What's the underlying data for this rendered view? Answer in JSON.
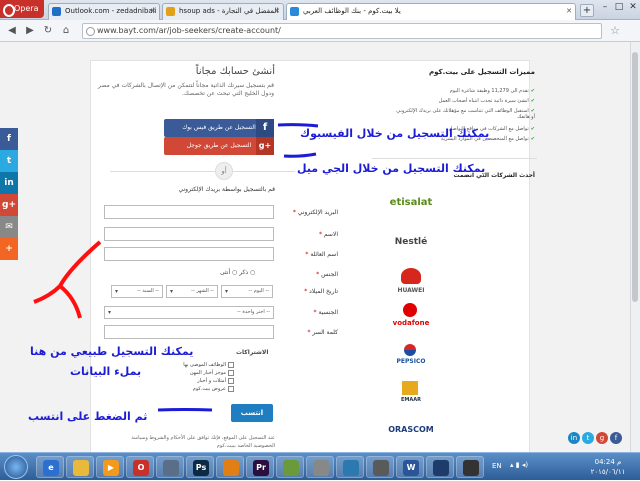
{
  "browser": {
    "opera_label": "Opera",
    "tabs": [
      {
        "title": "Outlook.com - zedadnibali",
        "color": "#1f6fc4"
      },
      {
        "title": "hsoup ads - المفضل في التجارة",
        "color": "#e5a01a"
      },
      {
        "title": "يلا بيت.كوم - بنك الوظائف العربي",
        "color": "#2b8ad8"
      }
    ],
    "url": "www.bayt.com/ar/job-seekers/create-account/",
    "add_tab": "+"
  },
  "form": {
    "title": "أنشئ حسابك مجاناً",
    "intro": "قم بتسجيل سيرتك الذاتية مجاناً لتتمكن من الإتصال بالشركات في مصر ودول الخليج التي تبحث عن تخصصك.",
    "facebook_btn": "التسجيل عن طريق فيس بوك",
    "google_btn": "التسجيل عن طريق جوجل",
    "or": "أو",
    "email_section": "قم بالتسجيل بواسطة بريدك الإلكتروني",
    "labels": {
      "email": "البريد الإلكتروني",
      "first": "الاسم",
      "last": "اسم العائلة",
      "gender": "الجنس",
      "dob": "تاريخ الميلاد",
      "nationality": "الجنسية",
      "password": "كلمة السر"
    },
    "gender_options": "ذكر ○  أنثى ○",
    "dob_day": "-- اليوم --",
    "dob_month": "-- الشهر --",
    "dob_year": "-- السنة --",
    "nationality_placeholder": "-- اختر واحدة --",
    "subs_title": "الاشتراكات",
    "subs": [
      "الوظائف الموصى بها",
      "موجز أخبار المهن",
      "أمثلات و أخبار",
      "عروض بيت.كوم"
    ],
    "submit": "انتسب",
    "terms": "عند التسجيل على الموقع، فإنك توافق على الأحكام والشروط وسياسة الخصوصية الخاصة ببيت.كوم"
  },
  "right": {
    "heading": "مميزات التسجيل على بيت.كوم",
    "items": [
      "تقدم الى 11,279 وظيفة شاغرة اليوم",
      "انشئ سيرة ذاتية تجذب انتباه أصحاب العمل",
      "استقبل الوظائف التي تتناسب مع مؤهلاتك على بريدك الإلكتروني أو هاتفك",
      "تواصل مع الشركات في مواقع التواصل",
      "تواصل مع المتخصصين في الموارد البشرية"
    ],
    "companies_heading": "أحدث الشركات التي انضمت",
    "logos": [
      "etisalat",
      "Nestlé",
      "HUAWEI",
      "vodafone",
      "PEPSICO",
      "EMAAR",
      "ORASCOM"
    ]
  },
  "annotations": {
    "facebook": "يمكنك التسجيل من خلال الفيسبوك",
    "gmail": "يمكنك التسجيل من خلال الجي ميل",
    "fill": "يمكنك التسجيل طبيعي من هنا",
    "fill2": "بملء البيانات",
    "submit": "ثم الضغط على انتسب"
  },
  "social": [
    "f",
    "t",
    "in",
    "g+",
    "✉",
    "+"
  ],
  "taskbar": {
    "lang": "EN",
    "time": "04:24 م",
    "date": "٢٠١٥/٠٦/١١"
  }
}
